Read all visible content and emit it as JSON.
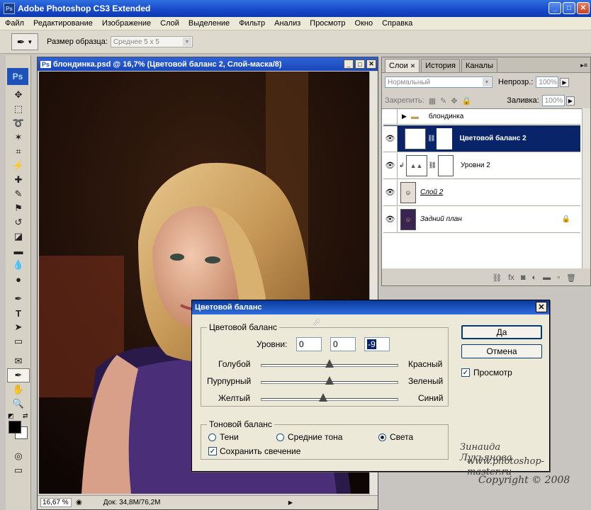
{
  "app": {
    "title": "Adobe Photoshop CS3 Extended",
    "logo": "Ps"
  },
  "menu": [
    "Файл",
    "Редактирование",
    "Изображение",
    "Слой",
    "Выделение",
    "Фильтр",
    "Анализ",
    "Просмотр",
    "Окно",
    "Справка"
  ],
  "options": {
    "sample_size_label": "Размер образца:",
    "sample_size_value": "Среднее 5 x 5"
  },
  "document": {
    "title": "блондинка.psd @ 16,7% (Цветовой баланс 2, Слой-маска/8)",
    "zoom": "16,67 %",
    "doc_info": "Док: 34,8M/76,2M"
  },
  "panel": {
    "tabs": [
      "Слои",
      "История",
      "Каналы"
    ],
    "blend_mode": "Нормальный",
    "opacity_label": "Непрозр.:",
    "opacity_value": "100%",
    "lock_label": "Закрепить:",
    "fill_label": "Заливка:",
    "fill_value": "100%",
    "layers": [
      {
        "name": "блондинка"
      },
      {
        "name": "Цветовой баланс 2"
      },
      {
        "name": "Уровни 2"
      },
      {
        "name": "Слой 2"
      },
      {
        "name": "Задний план"
      }
    ]
  },
  "dialog": {
    "title": "Цветовой баланс",
    "color_balance_group": "Цветовой баланс",
    "levels_label": "Уровни:",
    "levels": [
      "0",
      "0",
      "-9"
    ],
    "sliders": [
      {
        "left": "Голубой",
        "right": "Красный",
        "value": 0
      },
      {
        "left": "Пурпурный",
        "right": "Зеленый",
        "value": 0
      },
      {
        "left": "Желтый",
        "right": "Синий",
        "value": -9
      }
    ],
    "tone_group": "Тоновой баланс",
    "tones": [
      "Тени",
      "Средние тона",
      "Света"
    ],
    "selected_tone": "Света",
    "preserve_luminosity": "Сохранить свечение",
    "ok": "Да",
    "cancel": "Отмена",
    "preview": "Просмотр"
  },
  "watermark": {
    "line1": "Зинаида Лукьянова",
    "line2": "www.photoshop-master.ru",
    "line3": "Copyright © 2008"
  }
}
